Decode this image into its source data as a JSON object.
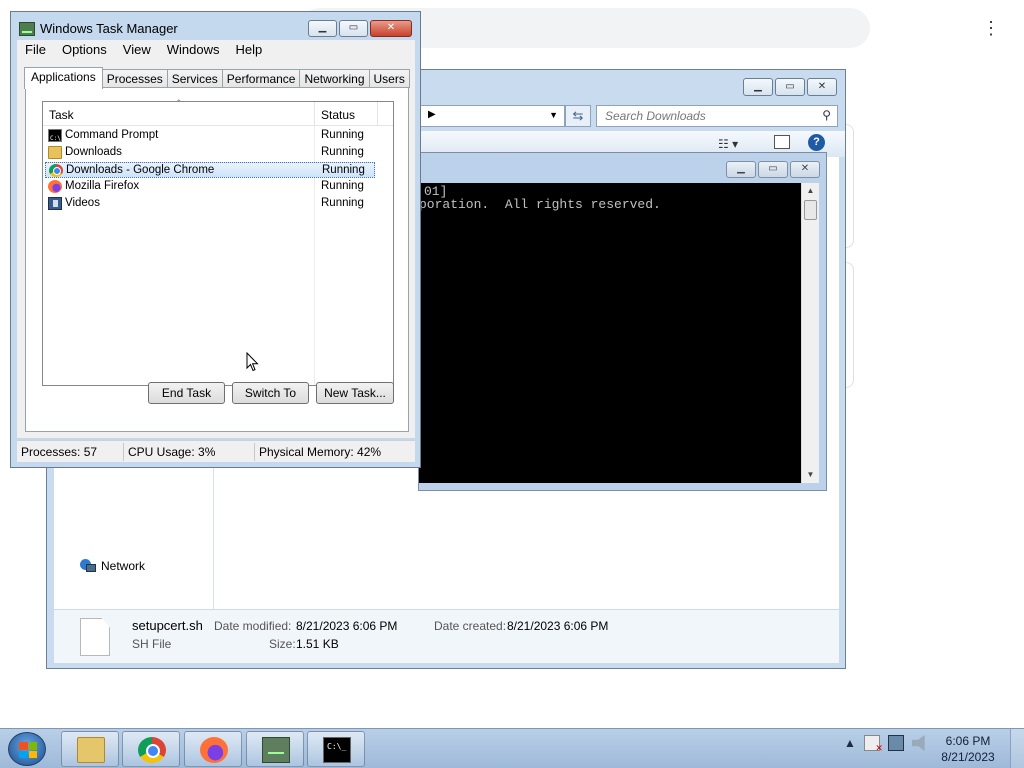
{
  "chrome": {
    "menu_icon": "⋮"
  },
  "explorer": {
    "search_placeholder": "Search Downloads",
    "nav_item_network": "Network",
    "details": {
      "file_name": "setupcert.sh",
      "file_type": "SH File",
      "date_modified_label": "Date modified:",
      "date_modified": "8/21/2023 6:06 PM",
      "date_created_label": "Date created:",
      "date_created": "8/21/2023 6:06 PM",
      "size_label": "Size:",
      "size": "1.51 KB"
    }
  },
  "cmd": {
    "line1": "01]",
    "line2": "poration.  All rights reserved."
  },
  "taskmgr": {
    "title": "Windows Task Manager",
    "menu": [
      "File",
      "Options",
      "View",
      "Windows",
      "Help"
    ],
    "tabs": [
      "Applications",
      "Processes",
      "Services",
      "Performance",
      "Networking",
      "Users"
    ],
    "columns": {
      "task": "Task",
      "status": "Status"
    },
    "rows": [
      {
        "task": "Command Prompt",
        "status": "Running",
        "icon": "cmd-icon"
      },
      {
        "task": "Downloads",
        "status": "Running",
        "icon": "folder-icon"
      },
      {
        "task": "Downloads - Google Chrome",
        "status": "Running",
        "icon": "chrome-icon"
      },
      {
        "task": "Mozilla Firefox",
        "status": "Running",
        "icon": "firefox-icon"
      },
      {
        "task": "Videos",
        "status": "Running",
        "icon": "video-library-icon"
      }
    ],
    "buttons": {
      "end_task": "End Task",
      "switch_to": "Switch To",
      "new_task": "New Task..."
    },
    "status": {
      "processes": "Processes: 57",
      "cpu": "CPU Usage: 3%",
      "memory": "Physical Memory: 42%"
    }
  },
  "taskbar": {
    "clock_time": "6:06 PM",
    "clock_date": "8/21/2023",
    "tray_arrow": "▲"
  }
}
